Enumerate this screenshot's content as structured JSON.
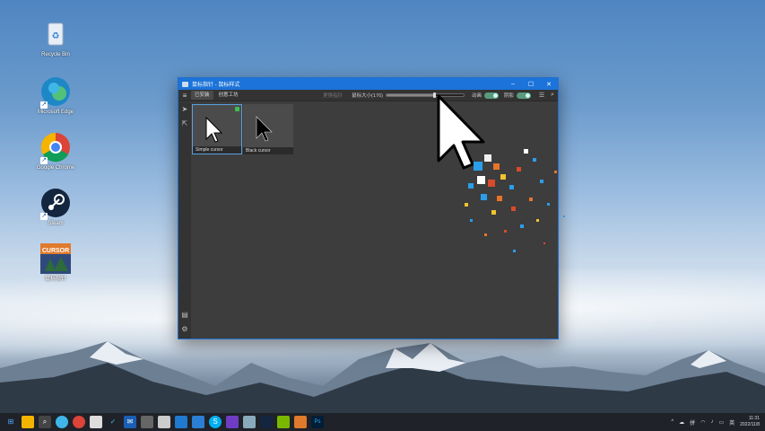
{
  "desktop": {
    "icons": [
      {
        "label": "Recycle Bin",
        "icon": "recycle-bin-icon"
      },
      {
        "label": "Microsoft Edge",
        "icon": "edge-icon"
      },
      {
        "label": "Google Chrome",
        "icon": "chrome-icon"
      },
      {
        "label": "Steam",
        "icon": "steam-icon"
      },
      {
        "label": "鼠标指针",
        "icon": "cursor-app-icon"
      }
    ]
  },
  "window": {
    "title": "鼠标指针 - 鼠标样式",
    "controls": {
      "minimize": "–",
      "maximize": "☐",
      "close": "✕"
    },
    "toolbar": {
      "tabs": [
        {
          "label": "已安装",
          "active": true
        },
        {
          "label": "创意工坊",
          "active": false
        }
      ],
      "dim_label": "更换指针",
      "size_label": "鼠标大小(176)",
      "size_value": 176,
      "size_fraction": 0.62,
      "toggle1_label": "动画",
      "toggle2_label": "阴影",
      "toggle1_on": true,
      "toggle2_on": true
    },
    "cursors": [
      {
        "name": "Simple cursor",
        "selected": true,
        "color": "#ffffff"
      },
      {
        "name": "Black cursor",
        "selected": false,
        "color": "#000000"
      }
    ]
  },
  "taskbar": {
    "apps": [
      "windows-start-icon",
      "search-icon",
      "file-explorer-icon",
      "edge-icon",
      "chrome-icon",
      "notepad-icon",
      "check-icon",
      "mail-icon",
      "app-icon",
      "terminal-icon",
      "vscode-icon",
      "store-icon",
      "skype-icon",
      "vs-icon",
      "photos-icon",
      "steam-icon",
      "green-app-icon",
      "cursor-app-icon",
      "photoshop-icon"
    ],
    "tray": {
      "input": "拼",
      "lang": "英",
      "time": "11:31",
      "date": "2022/11/8"
    }
  },
  "colors": {
    "accent": "#1c73d9",
    "window_bg": "#3c3c3c",
    "taskbar": "#1f2229"
  }
}
